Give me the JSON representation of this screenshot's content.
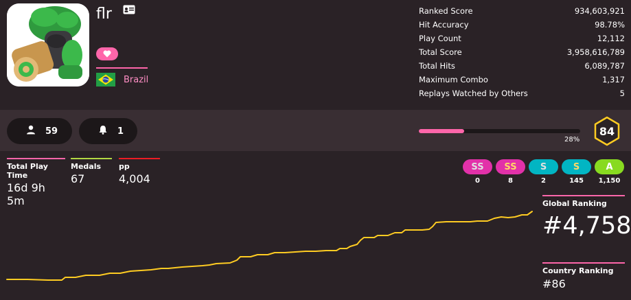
{
  "user": {
    "name": "flr",
    "country": "Brazil"
  },
  "stats": [
    {
      "label": "Ranked Score",
      "value": "934,603,921"
    },
    {
      "label": "Hit Accuracy",
      "value": "98.78%"
    },
    {
      "label": "Play Count",
      "value": "12,112"
    },
    {
      "label": "Total Score",
      "value": "3,958,616,789"
    },
    {
      "label": "Total Hits",
      "value": "6,089,787"
    },
    {
      "label": "Maximum Combo",
      "value": "1,317"
    },
    {
      "label": "Replays Watched by Others",
      "value": "5"
    }
  ],
  "social": {
    "followers": "59",
    "mapping_subscribers": "1"
  },
  "level": {
    "progress_label": "28%",
    "progress_fraction": 0.28,
    "number": "84"
  },
  "info": [
    {
      "label": "Total Play Time",
      "value": "16d 9h 5m",
      "color": "#ff66aa"
    },
    {
      "label": "Medals",
      "value": "67",
      "color": "#b3d944"
    },
    {
      "label": "pp",
      "value": "4,004",
      "color": "#ed1c24"
    }
  ],
  "grades": [
    {
      "label": "SS",
      "count": "0",
      "color": "#e231a9",
      "text_color": "#e0e0e0"
    },
    {
      "label": "SS",
      "count": "8",
      "color": "#e231a9",
      "text_color": "#ffd866"
    },
    {
      "label": "S",
      "count": "2",
      "color": "#02b5c3",
      "text_color": "#e0e0e0"
    },
    {
      "label": "S",
      "count": "145",
      "color": "#02b5c3",
      "text_color": "#ffd866"
    },
    {
      "label": "A",
      "count": "1,150",
      "color": "#88da20",
      "text_color": "#ffffff"
    }
  ],
  "ranking": {
    "global_label": "Global Ranking",
    "global_value": "#4,758",
    "country_label": "Country Ranking",
    "country_value": "#86"
  },
  "colors": {
    "accent": "#ff66aa",
    "graph_line": "#ffcc22",
    "level_ring": "#ffcc22"
  }
}
